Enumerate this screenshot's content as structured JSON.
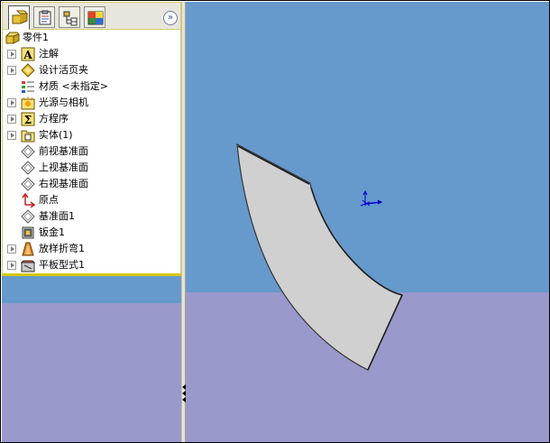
{
  "colors": {
    "viewport_sky": "#6699cc",
    "viewport_floor": "#9999cc",
    "part_face": "#d0d0d0",
    "part_edge": "#333333",
    "tree_separator": "#d6c800",
    "triad_axis": "#0000cc"
  },
  "manager_tabs": [
    {
      "icon": "feature-manager-icon",
      "active": true
    },
    {
      "icon": "property-manager-icon",
      "active": false
    },
    {
      "icon": "configuration-manager-icon",
      "active": false
    },
    {
      "icon": "display-manager-icon",
      "active": false
    }
  ],
  "collapse_button": {
    "label": "»"
  },
  "tree": {
    "root": {
      "label": "零件1",
      "icon": "part-icon"
    },
    "items": [
      {
        "label": "注解",
        "icon": "annotations-icon",
        "expandable": true
      },
      {
        "label": "设计活页夹",
        "icon": "design-binder-icon",
        "expandable": true
      },
      {
        "label": "材质 <未指定>",
        "icon": "material-icon",
        "expandable": false
      },
      {
        "label": "光源与相机",
        "icon": "lights-cameras-icon",
        "expandable": true
      },
      {
        "label": "方程序",
        "icon": "equations-icon",
        "expandable": true
      },
      {
        "label": "实体(1)",
        "icon": "solid-bodies-icon",
        "expandable": true
      },
      {
        "label": "前视基准面",
        "icon": "plane-icon",
        "expandable": false
      },
      {
        "label": "上视基准面",
        "icon": "plane-icon",
        "expandable": false
      },
      {
        "label": "右视基准面",
        "icon": "plane-icon",
        "expandable": false
      },
      {
        "label": "原点",
        "icon": "origin-icon",
        "expandable": false
      },
      {
        "label": "基准面1",
        "icon": "plane-icon",
        "expandable": false
      },
      {
        "label": "钣金1",
        "icon": "sheet-metal-icon",
        "expandable": false
      },
      {
        "label": "放样折弯1",
        "icon": "lofted-bend-icon",
        "expandable": true
      },
      {
        "label": "平板型式1",
        "icon": "flat-pattern-icon",
        "expandable": true
      }
    ]
  }
}
